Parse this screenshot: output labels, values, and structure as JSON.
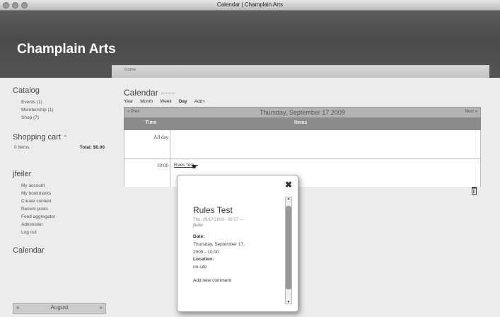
{
  "window": {
    "title": "Calendar | Champlain Arts"
  },
  "header": {
    "site_name": "Champlain Arts",
    "breadcrumb": "Home"
  },
  "sidebar": {
    "catalog_title": "Catalog",
    "catalog_items": [
      "Events (1)",
      "Membership (1)",
      "Shop (7)"
    ],
    "cart_title": "Shopping cart",
    "cart_items": "0 Items",
    "cart_total": "Total: $0.00",
    "user_title": "jfeiler",
    "user_items": [
      "My account",
      "My bookmarks",
      "Create content",
      "Recent posts",
      "Feed aggregator",
      "Administer",
      "Log out"
    ],
    "calendar_title": "Calendar",
    "calendar_month": "August",
    "calendar_prev": "«",
    "calendar_next": "»"
  },
  "main": {
    "title": "Calendar",
    "tabs": [
      "Year",
      "Month",
      "Week",
      "Day",
      "Add+"
    ],
    "active_tab": "Day",
    "nav_prev": "« Prev",
    "nav_next": "Next »",
    "date_heading": "Thursday, September 17 2009",
    "col_time": "Time",
    "col_items": "Items",
    "allday_label": "All day",
    "time_label": "10:00",
    "event_link": "Rules Test"
  },
  "popup": {
    "event_title": "Rules Test",
    "posted": "Thu, 09/17/2009 - 09:57 —",
    "author": "jfeiler",
    "date_label": "Date:",
    "date_value_1": "Thursday, September 17,",
    "date_value_2": "2009 - 10:00",
    "location_label": "Location:",
    "location_value": "on-site",
    "comment_link": "Add new comment",
    "close_symbol": "✖"
  },
  "icons": [
    "close-icon",
    "trash-icon",
    "cursor-icon",
    "cart-arrow-icon"
  ]
}
